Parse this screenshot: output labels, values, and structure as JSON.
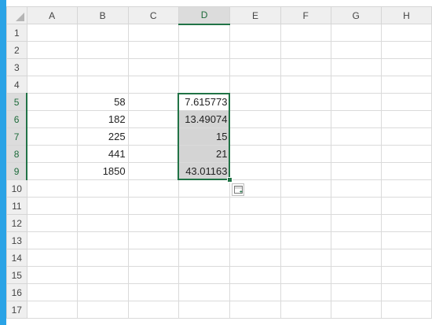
{
  "columns": [
    "A",
    "B",
    "C",
    "D",
    "E",
    "F",
    "G",
    "H"
  ],
  "rows": [
    {
      "num": "1",
      "cells": [
        "",
        "",
        "",
        "",
        "",
        "",
        "",
        ""
      ]
    },
    {
      "num": "2",
      "cells": [
        "",
        "",
        "",
        "",
        "",
        "",
        "",
        ""
      ]
    },
    {
      "num": "3",
      "cells": [
        "",
        "",
        "",
        "",
        "",
        "",
        "",
        ""
      ]
    },
    {
      "num": "4",
      "cells": [
        "",
        "",
        "",
        "",
        "",
        "",
        "",
        ""
      ]
    },
    {
      "num": "5",
      "cells": [
        "",
        "58",
        "",
        "7.615773",
        "",
        "",
        "",
        ""
      ]
    },
    {
      "num": "6",
      "cells": [
        "",
        "182",
        "",
        "13.49074",
        "",
        "",
        "",
        ""
      ]
    },
    {
      "num": "7",
      "cells": [
        "",
        "225",
        "",
        "15",
        "",
        "",
        "",
        ""
      ]
    },
    {
      "num": "8",
      "cells": [
        "",
        "441",
        "",
        "21",
        "",
        "",
        "",
        ""
      ]
    },
    {
      "num": "9",
      "cells": [
        "",
        "1850",
        "",
        "43.01163",
        "",
        "",
        "",
        ""
      ]
    },
    {
      "num": "10",
      "cells": [
        "",
        "",
        "",
        "",
        "",
        "",
        "",
        ""
      ]
    },
    {
      "num": "11",
      "cells": [
        "",
        "",
        "",
        "",
        "",
        "",
        "",
        ""
      ]
    },
    {
      "num": "12",
      "cells": [
        "",
        "",
        "",
        "",
        "",
        "",
        "",
        ""
      ]
    },
    {
      "num": "13",
      "cells": [
        "",
        "",
        "",
        "",
        "",
        "",
        "",
        ""
      ]
    },
    {
      "num": "14",
      "cells": [
        "",
        "",
        "",
        "",
        "",
        "",
        "",
        ""
      ]
    },
    {
      "num": "15",
      "cells": [
        "",
        "",
        "",
        "",
        "",
        "",
        "",
        ""
      ]
    },
    {
      "num": "16",
      "cells": [
        "",
        "",
        "",
        "",
        "",
        "",
        "",
        ""
      ]
    },
    {
      "num": "17",
      "cells": [
        "",
        "",
        "",
        "",
        "",
        "",
        "",
        ""
      ]
    }
  ],
  "selection": {
    "column": "D",
    "rows": [
      "5",
      "6",
      "7",
      "8",
      "9"
    ]
  },
  "colors": {
    "accent": "#217346",
    "selection_fill": "#d4d4d4",
    "header_bg": "#efefef",
    "left_strip": "#2aa3e6"
  },
  "icons": {
    "corner": "select-all-triangle-icon",
    "quick_analysis": "quick-analysis-icon"
  }
}
